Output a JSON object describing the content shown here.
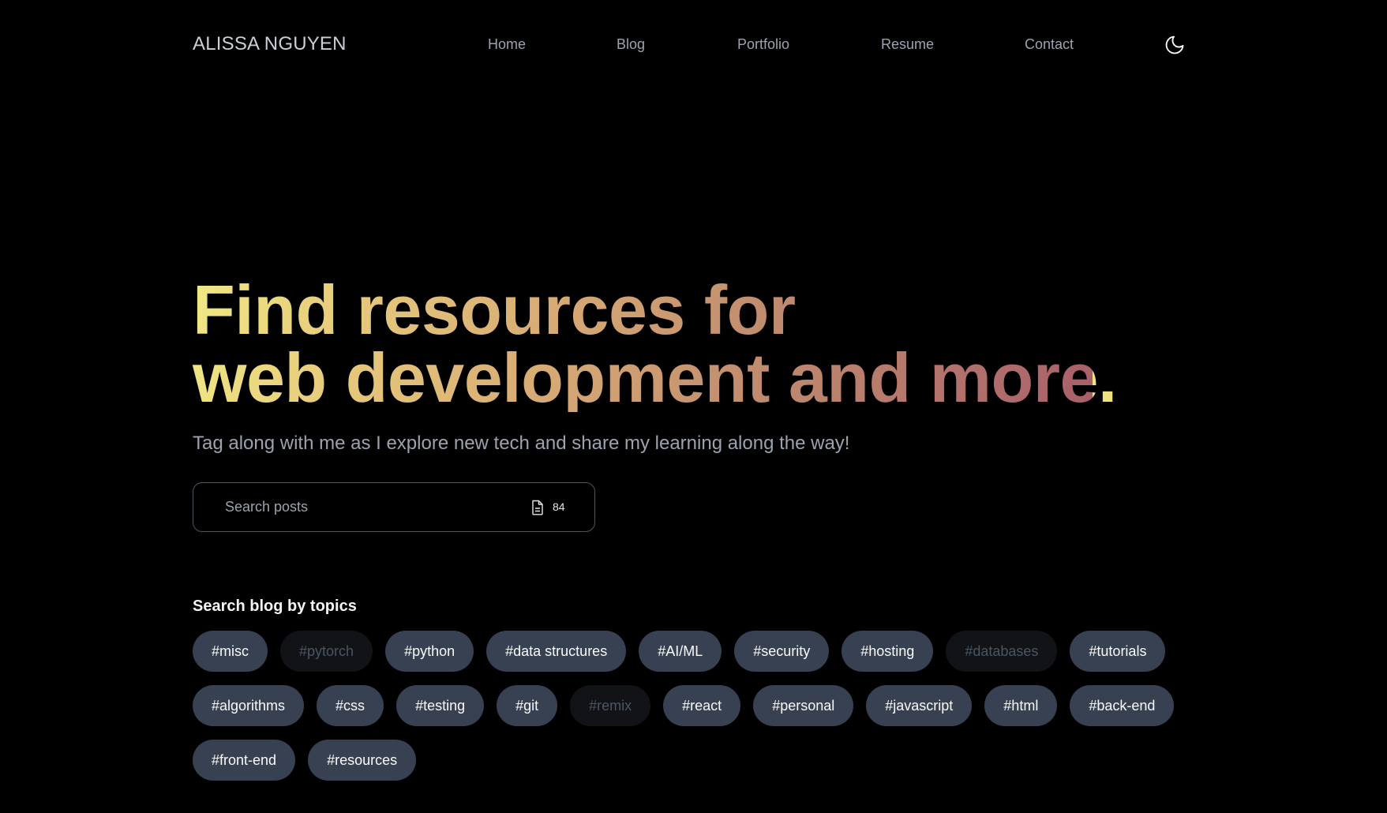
{
  "header": {
    "brand": "ALISSA NGUYEN",
    "nav": [
      {
        "label": "Home"
      },
      {
        "label": "Blog"
      },
      {
        "label": "Portfolio"
      },
      {
        "label": "Resume"
      },
      {
        "label": "Contact"
      }
    ],
    "theme_icon": "moon-icon"
  },
  "hero": {
    "title_line1": "Find resources for",
    "title_line2": "web development and more.",
    "subtitle": "Tag along with me as I explore new tech and share my learning along the way!",
    "gradient_colors": [
      "#f0e884",
      "#d5a774",
      "#a95f6a"
    ]
  },
  "search": {
    "placeholder": "Search posts",
    "value": "",
    "count_icon": "document-icon",
    "post_count": "84"
  },
  "topics": {
    "heading": "Search blog by topics",
    "tags": [
      {
        "label": "#misc",
        "state": "active"
      },
      {
        "label": "#pytorch",
        "state": "disabled"
      },
      {
        "label": "#python",
        "state": "active"
      },
      {
        "label": "#data structures",
        "state": "active"
      },
      {
        "label": "#AI/ML",
        "state": "active"
      },
      {
        "label": "#security",
        "state": "active"
      },
      {
        "label": "#hosting",
        "state": "active"
      },
      {
        "label": "#databases",
        "state": "disabled"
      },
      {
        "label": "#tutorials",
        "state": "active"
      },
      {
        "label": "#algorithms",
        "state": "active"
      },
      {
        "label": "#css",
        "state": "active"
      },
      {
        "label": "#testing",
        "state": "active"
      },
      {
        "label": "#git",
        "state": "active"
      },
      {
        "label": "#remix",
        "state": "disabled"
      },
      {
        "label": "#react",
        "state": "active"
      },
      {
        "label": "#personal",
        "state": "active"
      },
      {
        "label": "#javascript",
        "state": "active"
      },
      {
        "label": "#html",
        "state": "active"
      },
      {
        "label": "#back-end",
        "state": "active"
      },
      {
        "label": "#front-end",
        "state": "active"
      },
      {
        "label": "#resources",
        "state": "active"
      }
    ]
  },
  "colors": {
    "background": "#000000",
    "tag_bg": "#374151",
    "tag_disabled_bg": "#111317",
    "muted_text": "#9ca3af"
  }
}
